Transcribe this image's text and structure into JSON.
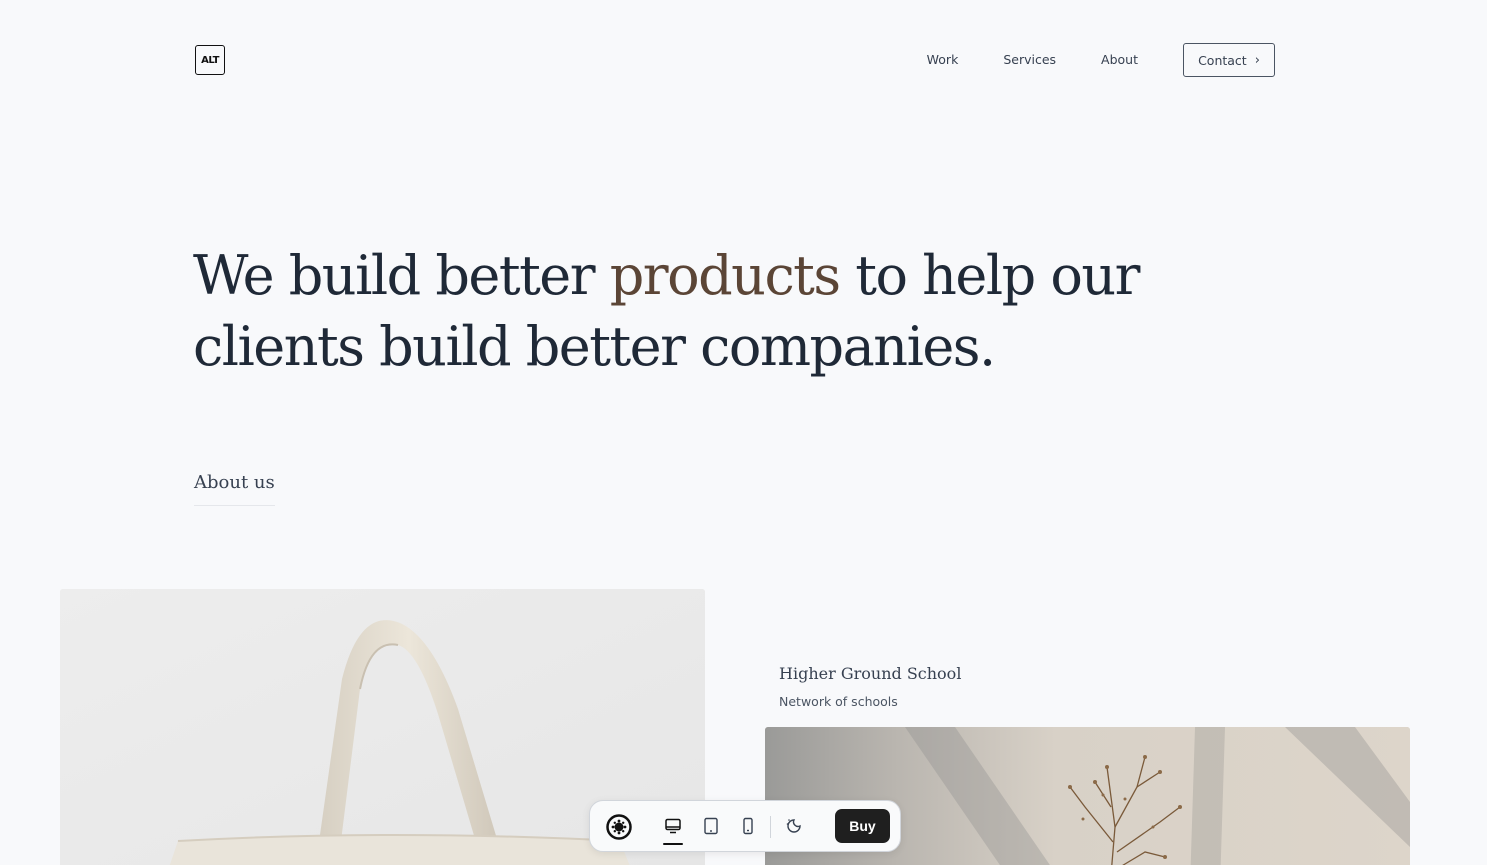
{
  "header": {
    "logo_text": "ALT",
    "nav": {
      "work": "Work",
      "services": "Services",
      "about": "About",
      "contact": "Contact"
    }
  },
  "hero": {
    "headline_part1": "We build better ",
    "headline_accent": "products",
    "headline_part2": " to help our clients build better companies.",
    "accent_color": "#5b4536"
  },
  "section": {
    "about_us": "About us"
  },
  "project": {
    "title": "Higher Ground School",
    "subtitle": "Network of schools"
  },
  "toolbar": {
    "buy_label": "Buy",
    "icons": [
      "logo-icon",
      "desktop-icon",
      "tablet-icon",
      "mobile-icon",
      "theme-toggle-icon"
    ]
  },
  "colors": {
    "background": "#f8f9fb",
    "text": "#1f2937",
    "buy_button": "#1f1f1f"
  }
}
